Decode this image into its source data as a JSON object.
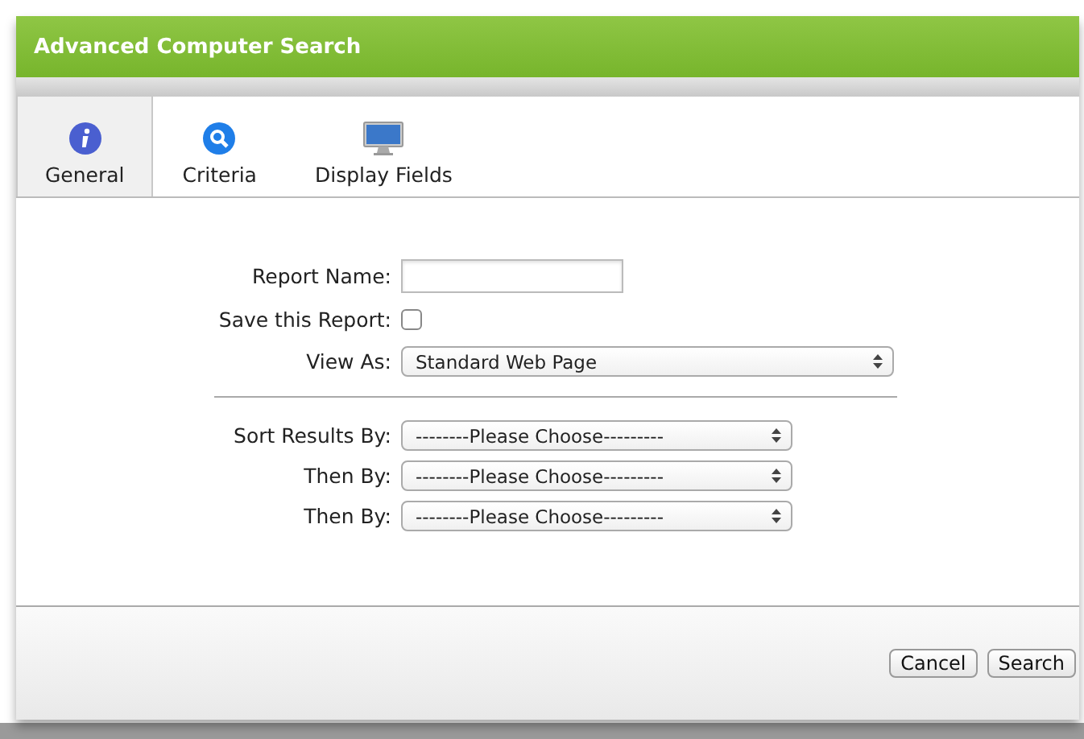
{
  "window": {
    "title": "Advanced Computer Search"
  },
  "tabs": [
    {
      "label": "General",
      "selected": true,
      "kind": "info"
    },
    {
      "label": "Criteria",
      "selected": false,
      "kind": "search"
    },
    {
      "label": "Display Fields",
      "selected": false,
      "kind": "monitor"
    }
  ],
  "fields": [
    {
      "label": "Report Name:",
      "kind": "text"
    },
    {
      "label": "Save this Report:",
      "kind": "checkbox",
      "checked": false
    },
    {
      "label": "View As:",
      "kind": "select",
      "value": "Standard Web Page"
    }
  ],
  "sort_fields": [
    {
      "label": "Sort Results By:",
      "kind": "select",
      "value": "--------Please Choose---------"
    },
    {
      "label": "Then By:",
      "kind": "select",
      "value": "--------Please Choose---------"
    },
    {
      "label": "Then By:",
      "kind": "select",
      "value": "--------Please Choose---------"
    }
  ],
  "buttons": [
    "Cancel",
    "Search"
  ]
}
